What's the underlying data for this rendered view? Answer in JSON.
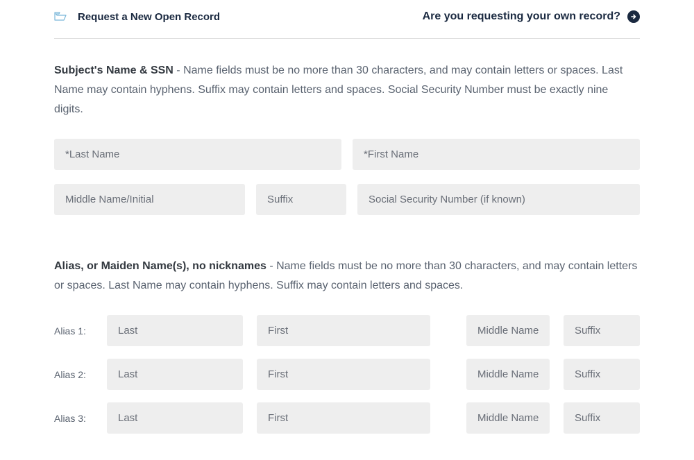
{
  "header": {
    "title": "Request a New Open Record",
    "own_record_prompt": "Are you requesting your own record?"
  },
  "subject_section": {
    "heading": "Subject's Name & SSN",
    "description": " - Name fields must be no more than 30 characters, and may contain letters or spaces. Last Name may contain hyphens. Suffix may contain letters and spaces. Social Security Number must be exactly nine digits.",
    "placeholders": {
      "last_name": "*Last Name",
      "first_name": "*First Name",
      "middle": "Middle Name/Initial",
      "suffix": "Suffix",
      "ssn": "Social Security Number (if known)"
    }
  },
  "alias_section": {
    "heading": "Alias, or Maiden Name(s), no nicknames",
    "description": " - Name fields must be no more than 30 characters, and may contain letters or spaces. Last Name may contain hyphens. Suffix may contain letters and spaces.",
    "rows": [
      {
        "label": "Alias 1:"
      },
      {
        "label": "Alias 2:"
      },
      {
        "label": "Alias 3:"
      }
    ],
    "placeholders": {
      "last": "Last",
      "first": "First",
      "middle": "Middle Name",
      "suffix": "Suffix"
    }
  }
}
